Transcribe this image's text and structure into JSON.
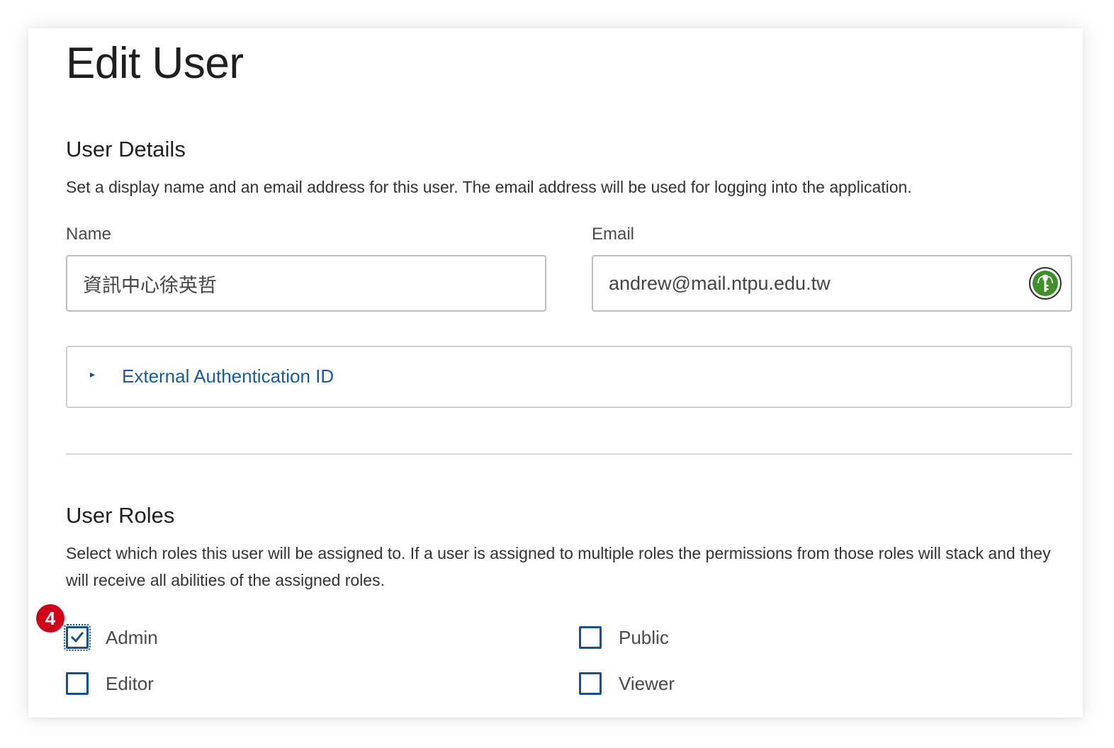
{
  "page": {
    "title": "Edit User"
  },
  "user_details": {
    "title": "User Details",
    "description": "Set a display name and an email address for this user. The email address will be used for logging into the application.",
    "name_label": "Name",
    "name_value": "資訊中心徐英哲",
    "email_label": "Email",
    "email_value": "andrew@mail.ntpu.edu.tw",
    "email_icon": "password-manager-key-icon",
    "external_auth_label": "External Authentication ID",
    "external_auth_caret": "▸"
  },
  "user_roles": {
    "title": "User Roles",
    "description": "Select which roles this user will be assigned to. If a user is assigned to multiple roles the permissions from those roles will stack and they will receive all abilities of the assigned roles.",
    "roles": [
      {
        "label": "Admin",
        "checked": true
      },
      {
        "label": "Public",
        "checked": false
      },
      {
        "label": "Editor",
        "checked": false
      },
      {
        "label": "Viewer",
        "checked": false
      }
    ]
  },
  "annotation": {
    "step_number": "4",
    "color": "#d0021b"
  },
  "colors": {
    "accent": "#1c4f8c",
    "link": "#1b5a9a",
    "key_icon": "#3f8f2a"
  }
}
